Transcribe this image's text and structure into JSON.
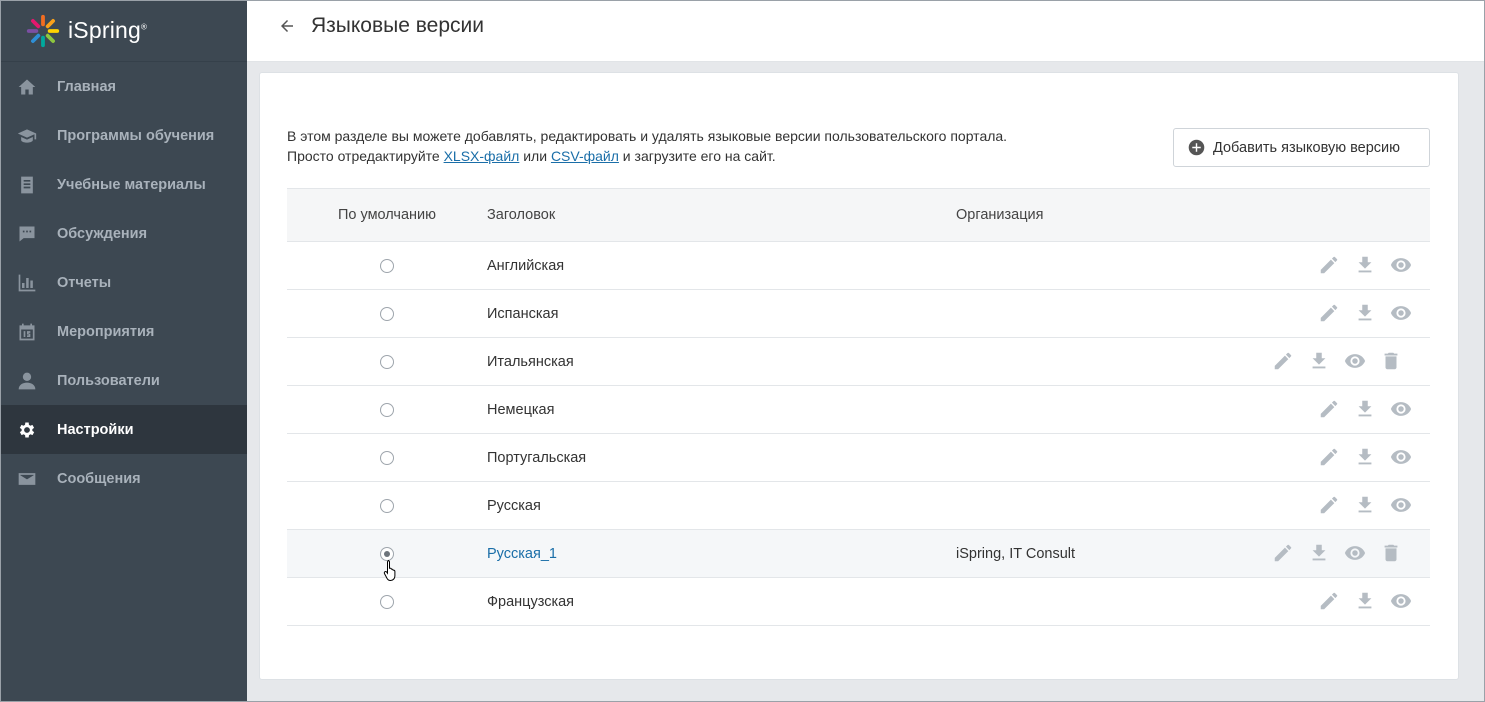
{
  "brand": {
    "name": "iSpring",
    "tm": "®"
  },
  "sidebar": {
    "items": [
      {
        "label": "Главная",
        "icon": "home-icon",
        "active": false
      },
      {
        "label": "Программы обучения",
        "icon": "graduation-cap-icon",
        "active": false
      },
      {
        "label": "Учебные материалы",
        "icon": "document-list-icon",
        "active": false
      },
      {
        "label": "Обсуждения",
        "icon": "chat-bubble-icon",
        "active": false
      },
      {
        "label": "Отчеты",
        "icon": "bar-chart-icon",
        "active": false
      },
      {
        "label": "Мероприятия",
        "icon": "calendar-icon",
        "active": false
      },
      {
        "label": "Пользователи",
        "icon": "user-icon",
        "active": false
      },
      {
        "label": "Настройки",
        "icon": "gear-icon",
        "active": true
      },
      {
        "label": "Сообщения",
        "icon": "envelope-icon",
        "active": false
      }
    ]
  },
  "header": {
    "title": "Языковые версии"
  },
  "main": {
    "desc_line1": "В этом разделе вы можете добавлять, редактировать и удалять языковые версии пользовательского портала.",
    "desc_line2_pre": "Просто отредактируйте ",
    "xlsx_link": "XLSX-файл",
    "desc_line2_mid": " или ",
    "csv_link": "CSV-файл",
    "desc_line2_post": " и загрузите его на сайт.",
    "add_button": "Добавить языковую версию"
  },
  "table": {
    "headers": {
      "default": "По умолчанию",
      "title": "Заголовок",
      "org": "Организация"
    },
    "rows": [
      {
        "title": "Английская",
        "org": "",
        "default": false,
        "deletable": false
      },
      {
        "title": "Испанская",
        "org": "",
        "default": false,
        "deletable": false
      },
      {
        "title": "Итальянская",
        "org": "",
        "default": false,
        "deletable": true
      },
      {
        "title": "Немецкая",
        "org": "",
        "default": false,
        "deletable": false
      },
      {
        "title": "Португальская",
        "org": "",
        "default": false,
        "deletable": false
      },
      {
        "title": "Русская",
        "org": "",
        "default": false,
        "deletable": false
      },
      {
        "title": "Русская_1",
        "org": "iSpring, IT Consult",
        "default": true,
        "deletable": true
      },
      {
        "title": "Французская",
        "org": "",
        "default": false,
        "deletable": false
      }
    ]
  },
  "colors": {
    "sidebar_bg": "#3d4852",
    "sidebar_active": "#2e363e",
    "link": "#1a6ea8",
    "icon_gray": "#b5bcc3"
  }
}
